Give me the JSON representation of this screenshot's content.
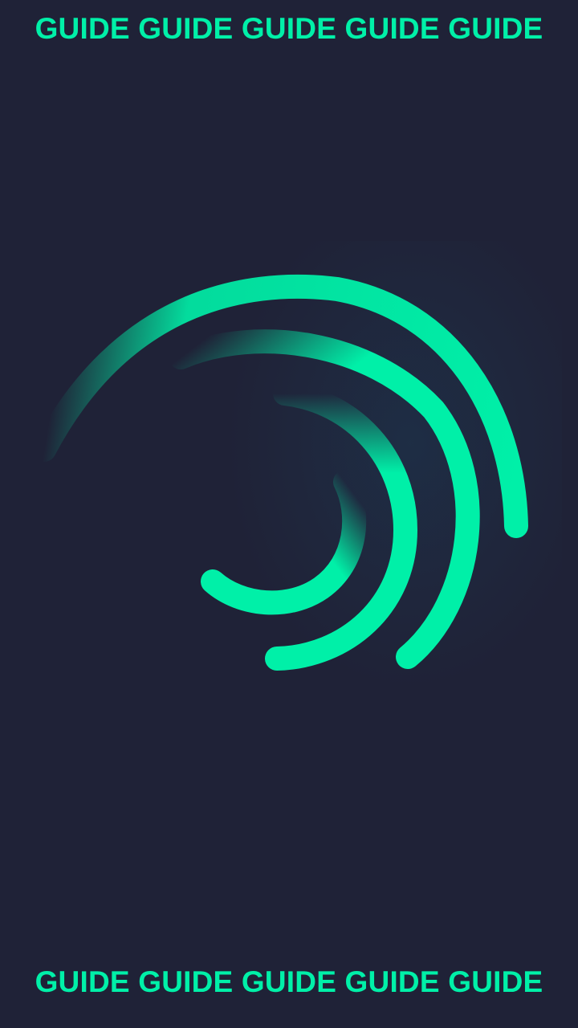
{
  "banner": {
    "top_text": "GUIDE GUIDE GUIDE GUIDE GUIDE",
    "bottom_text": "GUIDE GUIDE GUIDE GUIDE GUIDE"
  },
  "colors": {
    "background": "#1f2237",
    "accent": "#00f0a8"
  },
  "logo": {
    "icon": "swirl-arcs-logo-icon"
  }
}
